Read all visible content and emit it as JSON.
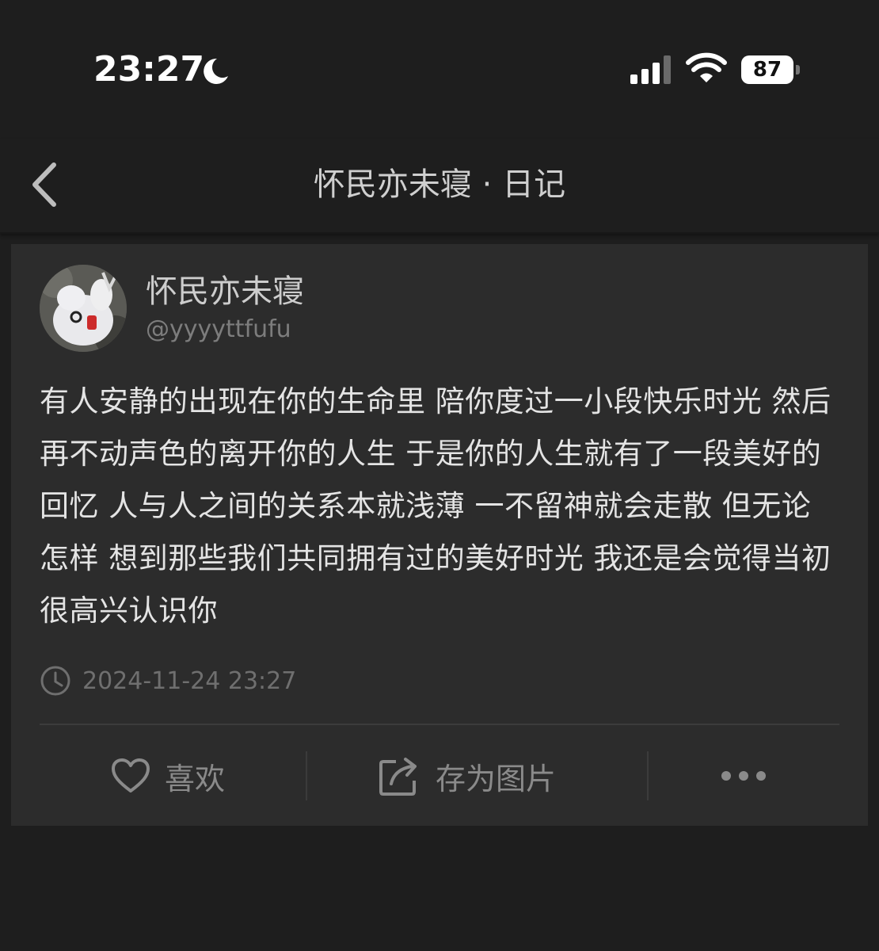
{
  "status_bar": {
    "time": "23:27",
    "battery": "87",
    "icons": [
      "moon-icon",
      "cellular-signal-icon",
      "wifi-icon",
      "battery-icon"
    ]
  },
  "nav": {
    "title": "怀民亦未寝 · 日记",
    "back_icon": "chevron-left-icon"
  },
  "post": {
    "author_name": "怀民亦未寝",
    "author_handle": "@yyyyttfufu",
    "text": "有人安静的出现在你的生命里 陪你度过一小段快乐时光 然后再不动声色的离开你的人生 于是你的人生就有了一段美好的回忆 人与人之间的关系本就浅薄 一不留神就会走散 但无论怎样 想到那些我们共同拥有过的美好时光 我还是会觉得当初很高兴认识你",
    "timestamp": "2024-11-24 23:27",
    "timestamp_icon": "clock-icon"
  },
  "actions": {
    "like_label": "喜欢",
    "like_icon": "heart-icon",
    "save_label": "存为图片",
    "save_icon": "share-export-icon",
    "more_icon": "more-dots-icon"
  },
  "colors": {
    "background": "#1e1e1e",
    "card": "#2c2c2c",
    "text_primary": "#e4e4e4",
    "text_muted": "#7d7d7d"
  }
}
